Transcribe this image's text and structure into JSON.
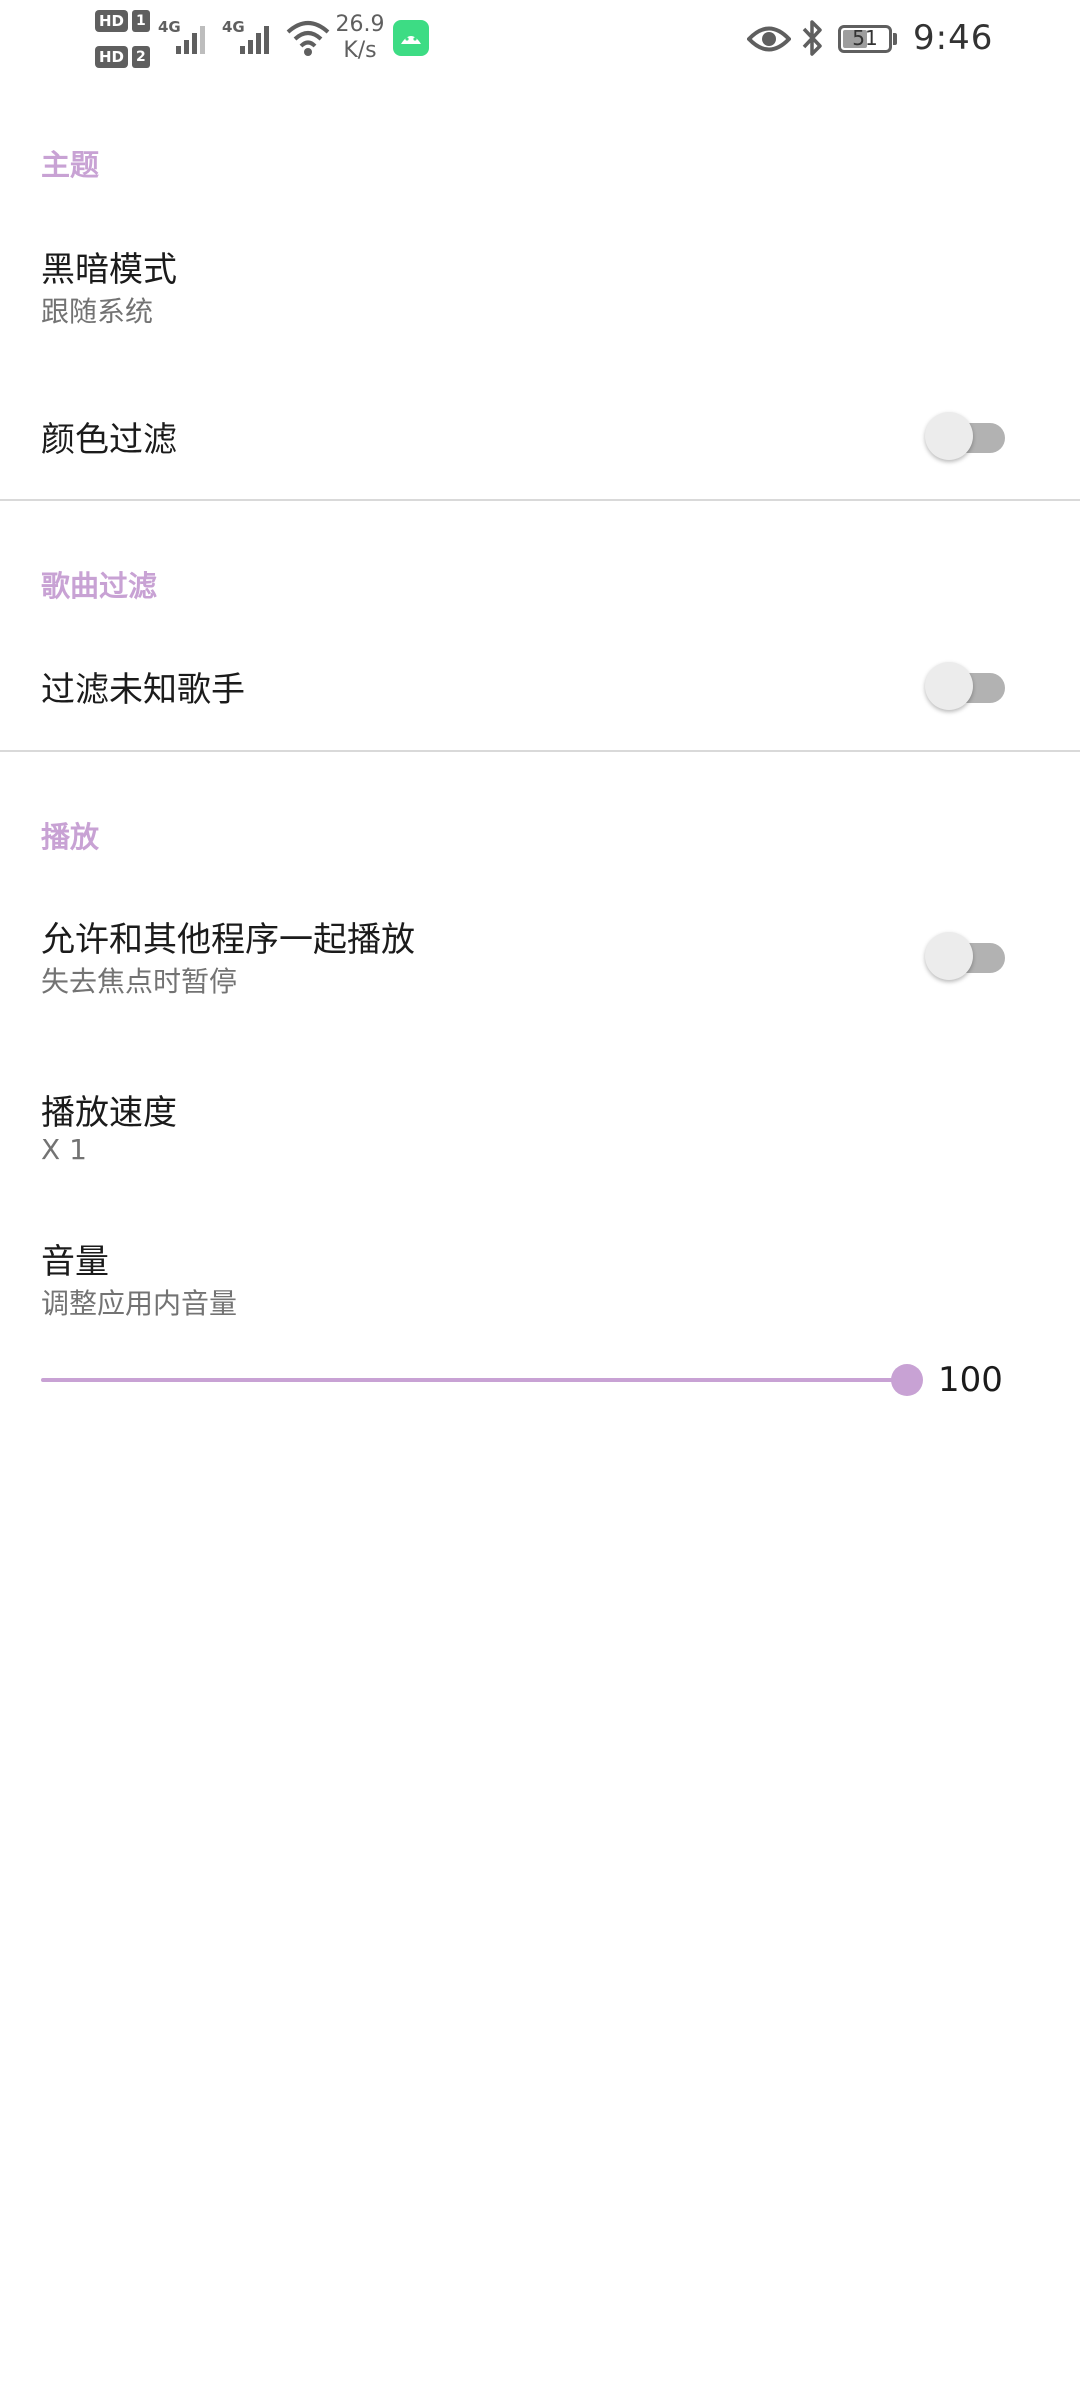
{
  "status_bar": {
    "hd1": "HD",
    "sim1": "1",
    "hd2": "HD",
    "sim2": "2",
    "net1": "4G",
    "net2": "4G",
    "speed_value": "26.9",
    "speed_unit": "K/s",
    "battery": "51",
    "time": "9:46"
  },
  "sections": {
    "theme": {
      "header": "主题",
      "dark_mode": {
        "title": "黑暗模式",
        "summary": "跟随系统"
      },
      "color_filter": {
        "title": "颜色过滤",
        "enabled": false
      }
    },
    "song_filter": {
      "header": "歌曲过滤",
      "filter_unknown_artist": {
        "title": "过滤未知歌手",
        "enabled": false
      }
    },
    "playback": {
      "header": "播放",
      "allow_mix": {
        "title": "允许和其他程序一起播放",
        "summary": "失去焦点时暂停",
        "enabled": false
      },
      "speed": {
        "title": "播放速度",
        "summary": "X 1"
      },
      "volume": {
        "title": "音量",
        "summary": "调整应用内音量",
        "value": "100",
        "level_fraction": 1.0
      }
    }
  },
  "colors": {
    "accent": "#c8a2d4",
    "switch_track_off": "#b2b2b2",
    "switch_thumb_off": "#ececec",
    "divider": "#d9d9d9"
  }
}
